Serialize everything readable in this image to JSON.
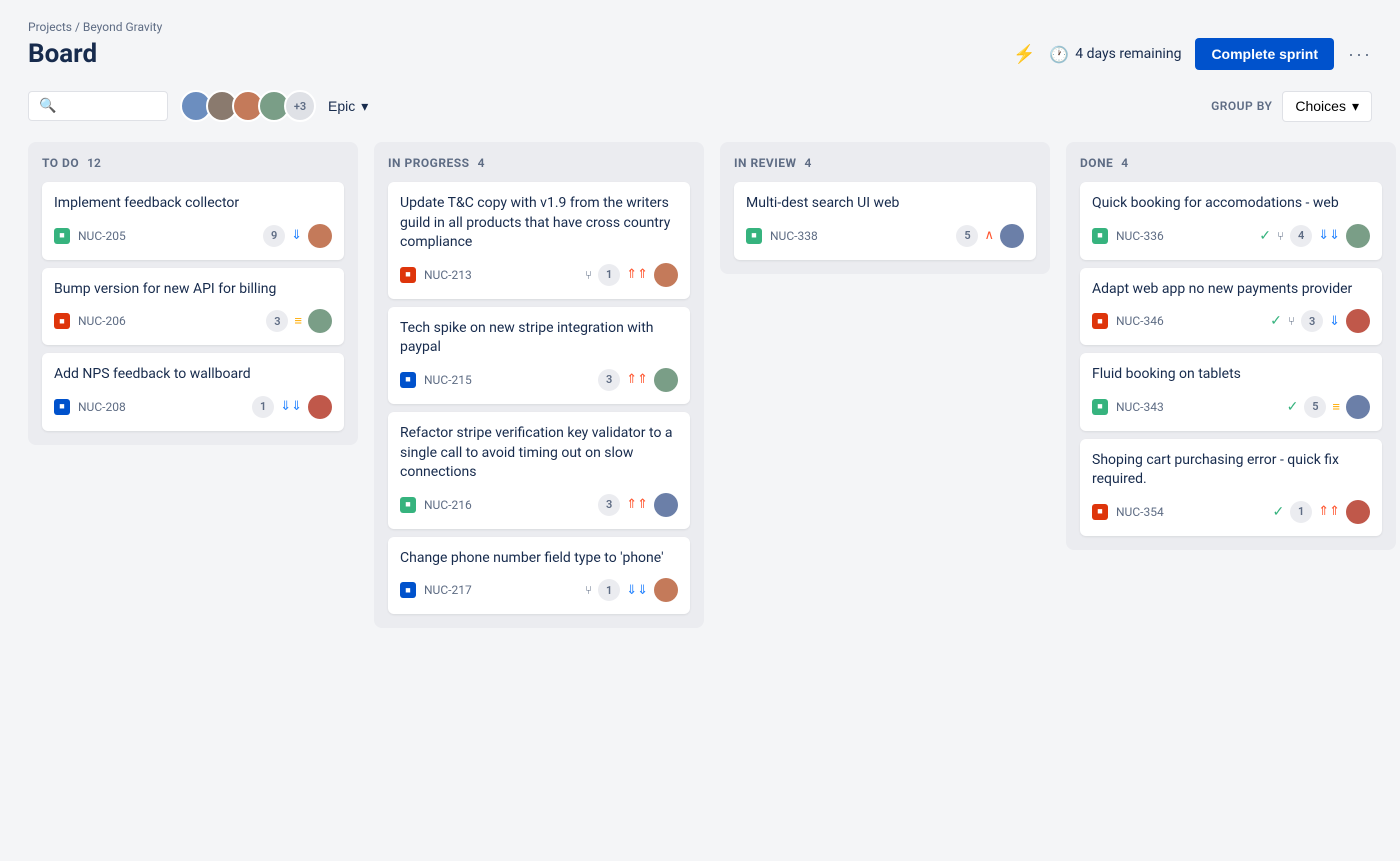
{
  "breadcrumb": "Projects / Beyond Gravity",
  "page_title": "Board",
  "header": {
    "sprint_days": "4 days remaining",
    "complete_sprint_btn": "Complete sprint",
    "more_options": "···"
  },
  "toolbar": {
    "search_placeholder": "",
    "epic_label": "Epic",
    "group_by_label": "GROUP BY",
    "choices_label": "Choices",
    "more_count": "+3"
  },
  "columns": [
    {
      "id": "todo",
      "title": "TO DO",
      "count": 12,
      "cards": [
        {
          "title": "Implement feedback collector",
          "tag": "NUC-205",
          "tag_color": "green",
          "count": 9,
          "priority": "low",
          "avatar_color": "av3"
        },
        {
          "title": "Bump version for new API for billing",
          "tag": "NUC-206",
          "tag_color": "red",
          "count": 3,
          "priority": "medium",
          "avatar_color": "av4"
        },
        {
          "title": "Add NPS feedback to wallboard",
          "tag": "NUC-208",
          "tag_color": "blue",
          "count": 1,
          "priority": "low-multi",
          "avatar_color": "av5"
        }
      ]
    },
    {
      "id": "inprogress",
      "title": "IN PROGRESS",
      "count": 4,
      "cards": [
        {
          "title": "Update T&C copy with v1.9 from the writers guild in all products that have cross country compliance",
          "tag": "NUC-213",
          "tag_color": "red",
          "count": 1,
          "priority": "high",
          "avatar_color": "av3",
          "branch": true
        },
        {
          "title": "Tech spike on new stripe integration with paypal",
          "tag": "NUC-215",
          "tag_color": "blue",
          "count": 3,
          "priority": "high",
          "avatar_color": "av4"
        },
        {
          "title": "Refactor stripe verification key validator to a single call to avoid timing out on slow connections",
          "tag": "NUC-216",
          "tag_color": "green",
          "count": 3,
          "priority": "high",
          "avatar_color": "av6"
        },
        {
          "title": "Change phone number field type to 'phone'",
          "tag": "NUC-217",
          "tag_color": "blue",
          "count": 1,
          "priority": "low-multi",
          "avatar_color": "av3",
          "branch": true
        }
      ]
    },
    {
      "id": "inreview",
      "title": "IN REVIEW",
      "count": 4,
      "cards": [
        {
          "title": "Multi-dest search UI web",
          "tag": "NUC-338",
          "tag_color": "green",
          "count": 5,
          "priority": "high-up",
          "avatar_color": "av6"
        }
      ]
    },
    {
      "id": "done",
      "title": "DONE",
      "count": 4,
      "cards": [
        {
          "title": "Quick booking for accomodations - web",
          "tag": "NUC-336",
          "tag_color": "green",
          "count": 4,
          "priority": "low-multi",
          "avatar_color": "av4",
          "check": true,
          "branch": true
        },
        {
          "title": "Adapt web app no new payments provider",
          "tag": "NUC-346",
          "tag_color": "red",
          "count": 3,
          "priority": "low",
          "avatar_color": "av5",
          "check": true,
          "branch": true
        },
        {
          "title": "Fluid booking on tablets",
          "tag": "NUC-343",
          "tag_color": "green",
          "count": 5,
          "priority": "medium",
          "avatar_color": "av6",
          "check": true
        },
        {
          "title": "Shoping cart purchasing error - quick fix required.",
          "tag": "NUC-354",
          "tag_color": "red",
          "count": 1,
          "priority": "high",
          "avatar_color": "av5",
          "check": true
        }
      ]
    }
  ]
}
